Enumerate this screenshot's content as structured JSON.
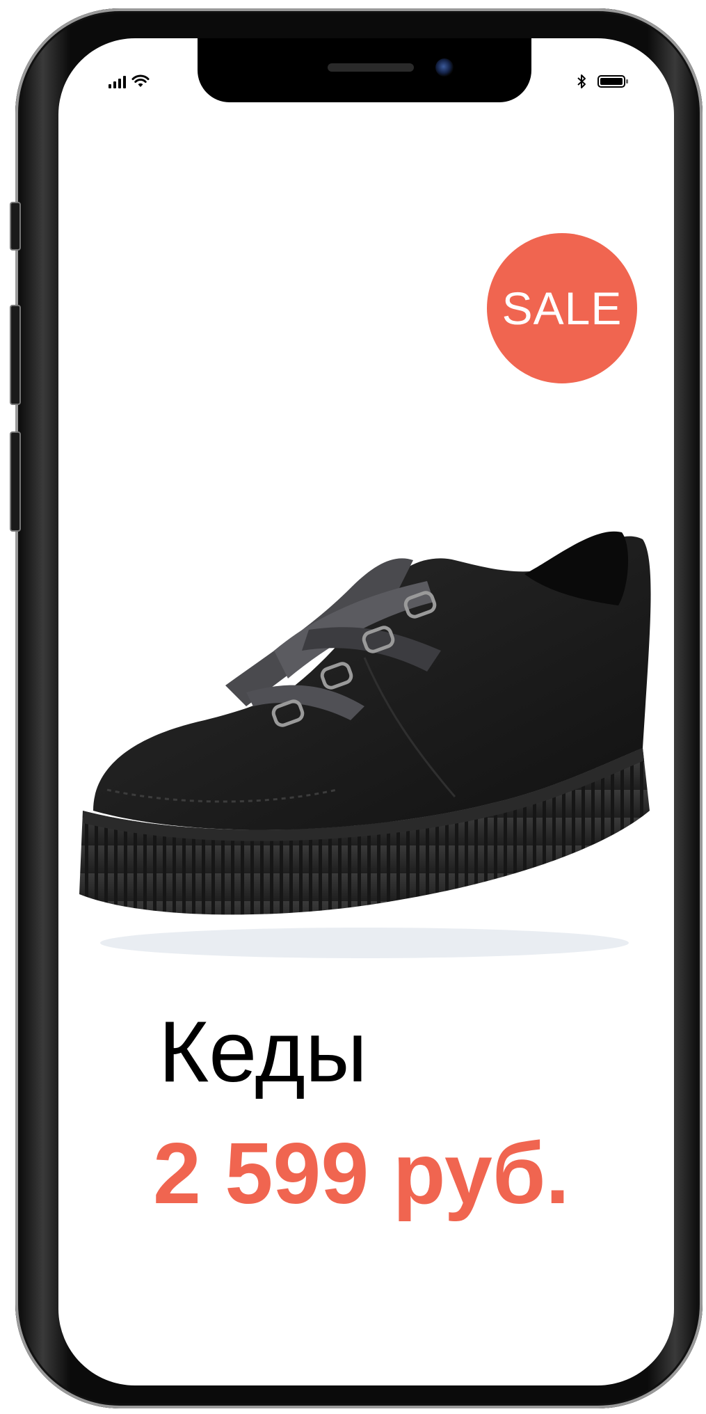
{
  "status_bar": {
    "icons": [
      "signal-bars-icon",
      "wifi-icon",
      "bluetooth-icon",
      "battery-icon"
    ]
  },
  "product": {
    "badge": "SALE",
    "name": "Кеды",
    "price": "2 599 руб.",
    "image_icon": "sneaker-image"
  },
  "colors": {
    "accent": "#f06550",
    "text": "#000000",
    "background": "#ffffff"
  }
}
